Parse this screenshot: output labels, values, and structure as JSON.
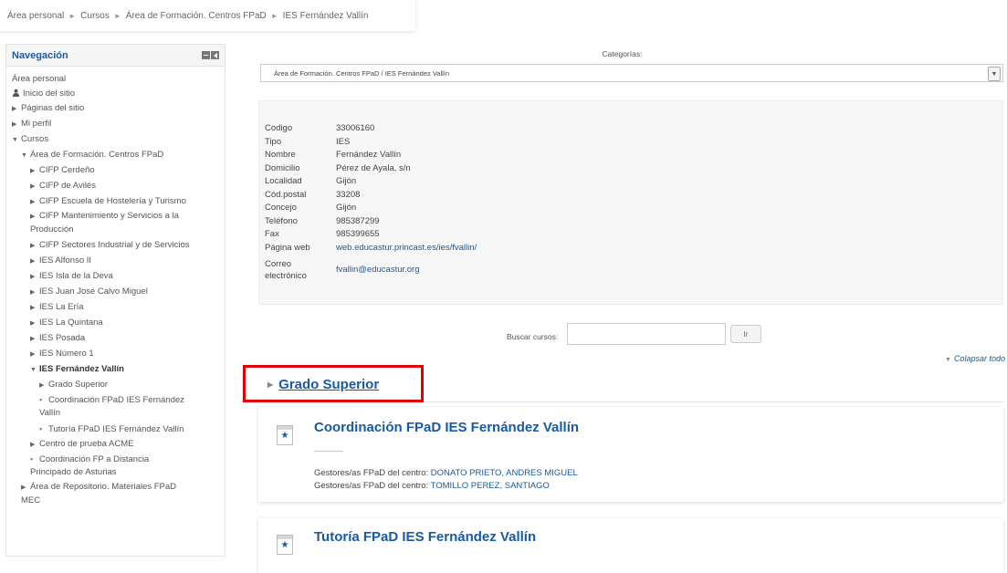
{
  "breadcrumb": {
    "items": [
      "Área personal",
      "Cursos",
      "Área de Formación. Centros FPaD",
      "IES Fernández Vallín"
    ],
    "separator": "►"
  },
  "navigation": {
    "title": "Navegación",
    "area_personal": "Área personal",
    "inicio": "Inicio del sitio",
    "paginas": "Páginas del sitio",
    "mi_perfil": "Mi perfil",
    "cursos": "Cursos",
    "area_formacion": "Área de Formación. Centros FPaD",
    "centros": [
      "CIFP Cerdeño",
      "CIFP de Avilés",
      "CIFP Escuela de Hostelería y Turismo",
      "CIFP Mantenimiento y Servicios a la Producción",
      "CIFP Sectores Industrial y de Servicios",
      "IES Alfonso II",
      "IES Isla de la Deva",
      "IES Juan José Calvo Miguel",
      "IES La Ería",
      "IES La Quintana",
      "IES Posada",
      "IES Número 1"
    ],
    "current_centro": "IES Fernández Vallín",
    "sub_items": [
      "Grado Superior",
      "Coordinación FPaD IES Fernández Vallín",
      "Tutoría FPaD IES Fernández Vallín"
    ],
    "after_items": [
      "Centro de prueba ACME",
      "Coordinación FP a Distancia Principado de Asturias"
    ],
    "repositorio": "Área de Repositorio. Materiales FPaD MEC"
  },
  "categories": {
    "label": "Categorías:",
    "selected": "Área de Formación. Centros FPaD / IES Fernández Vallín"
  },
  "centro_info": {
    "rows": [
      {
        "key": "Codigo",
        "value": "33006160"
      },
      {
        "key": "Tipo",
        "value": "IES"
      },
      {
        "key": "Nombre",
        "value": "Fernández Vallín"
      },
      {
        "key": "Domicilio",
        "value": "Pérez de Ayala, s/n"
      },
      {
        "key": "Localidad",
        "value": "Gijón"
      },
      {
        "key": "Cód.postal",
        "value": "33208"
      },
      {
        "key": "Concejo",
        "value": "Gijón"
      },
      {
        "key": "Teléfono",
        "value": "985387299"
      },
      {
        "key": "Fax",
        "value": "985399655"
      }
    ],
    "web_label": "Página web",
    "web_value": "web.educastur.princast.es/ies/fvallin/",
    "email_label_1": "Correo",
    "email_label_2": "electrónico",
    "email_value": "fvallin@educastur.org"
  },
  "search": {
    "label": "Buscar cursos:",
    "value": "",
    "button": "Ir"
  },
  "collapse_all": "Colapsar todo",
  "grado_superior": "Grado Superior",
  "courses": [
    {
      "title": "Coordinación FPaD IES Fernández Vallín",
      "teachers": [
        {
          "role": "Gestores/as FPaD del centro:",
          "names": "DONATO PRIETO, ANDRES MIGUEL"
        },
        {
          "role": "Gestores/as FPaD del centro:",
          "names": "TOMILLO PEREZ, SANTIAGO"
        }
      ]
    },
    {
      "title": "Tutoría FPaD IES Fernández Vallín"
    }
  ],
  "colors": {
    "link": "#1a5aa0",
    "highlight": "#e00000"
  }
}
